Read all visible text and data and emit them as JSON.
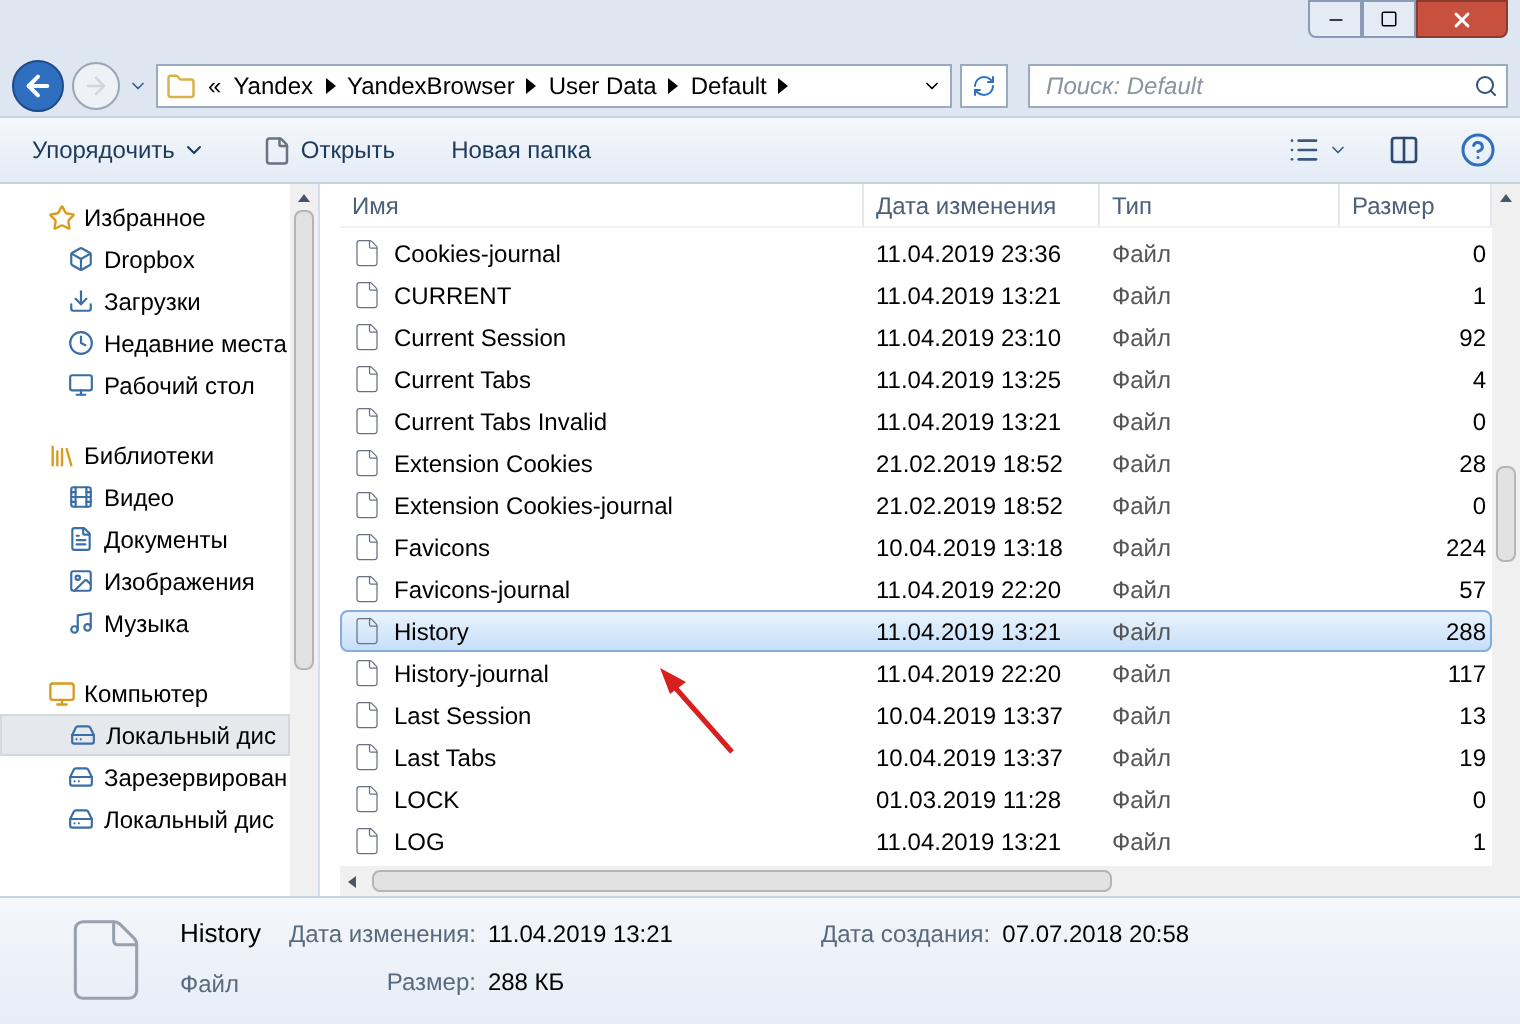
{
  "address": {
    "overflow": "«",
    "path": [
      "Yandex",
      "YandexBrowser",
      "User Data",
      "Default"
    ]
  },
  "search": {
    "placeholder": "Поиск: Default"
  },
  "toolbar": [
    {
      "label": "Упорядочить",
      "kind": "menu"
    },
    {
      "label": "Открыть",
      "kind": "open"
    },
    {
      "label": "Новая папка",
      "kind": "plain"
    }
  ],
  "nav": [
    {
      "label": "Избранное",
      "children": [
        {
          "label": "Dropbox",
          "selected": false
        },
        {
          "label": "Загрузки",
          "selected": false
        },
        {
          "label": "Недавние места",
          "selected": false
        },
        {
          "label": "Рабочий стол",
          "selected": false
        }
      ]
    },
    {
      "label": "Библиотеки",
      "children": [
        {
          "label": "Видео",
          "selected": false
        },
        {
          "label": "Документы",
          "selected": false
        },
        {
          "label": "Изображения",
          "selected": false
        },
        {
          "label": "Музыка",
          "selected": false
        }
      ]
    },
    {
      "label": "Компьютер",
      "children": [
        {
          "label": "Локальный дис",
          "selected": true
        },
        {
          "label": "Зарезервирован",
          "selected": false
        },
        {
          "label": "Локальный дис",
          "selected": false
        }
      ]
    }
  ],
  "columns": [
    "Имя",
    "Дата изменения",
    "Тип",
    "Размер"
  ],
  "rows": [
    {
      "name": "Cookies-journal",
      "date": "11.04.2019 23:36",
      "type": "Файл",
      "size": "0",
      "selected": false
    },
    {
      "name": "CURRENT",
      "date": "11.04.2019 13:21",
      "type": "Файл",
      "size": "1",
      "selected": false
    },
    {
      "name": "Current Session",
      "date": "11.04.2019 23:10",
      "type": "Файл",
      "size": "92",
      "selected": false
    },
    {
      "name": "Current Tabs",
      "date": "11.04.2019 13:25",
      "type": "Файл",
      "size": "4",
      "selected": false
    },
    {
      "name": "Current Tabs Invalid",
      "date": "11.04.2019 13:21",
      "type": "Файл",
      "size": "0",
      "selected": false
    },
    {
      "name": "Extension Cookies",
      "date": "21.02.2019 18:52",
      "type": "Файл",
      "size": "28",
      "selected": false
    },
    {
      "name": "Extension Cookies-journal",
      "date": "21.02.2019 18:52",
      "type": "Файл",
      "size": "0",
      "selected": false
    },
    {
      "name": "Favicons",
      "date": "10.04.2019 13:18",
      "type": "Файл",
      "size": "224",
      "selected": false
    },
    {
      "name": "Favicons-journal",
      "date": "11.04.2019 22:20",
      "type": "Файл",
      "size": "57",
      "selected": false
    },
    {
      "name": "History",
      "date": "11.04.2019 13:21",
      "type": "Файл",
      "size": "288",
      "selected": true
    },
    {
      "name": "History-journal",
      "date": "11.04.2019 22:20",
      "type": "Файл",
      "size": "117",
      "selected": false
    },
    {
      "name": "Last Session",
      "date": "10.04.2019 13:37",
      "type": "Файл",
      "size": "13",
      "selected": false
    },
    {
      "name": "Last Tabs",
      "date": "10.04.2019 13:37",
      "type": "Файл",
      "size": "19",
      "selected": false
    },
    {
      "name": "LOCK",
      "date": "01.03.2019 11:28",
      "type": "Файл",
      "size": "0",
      "selected": false
    },
    {
      "name": "LOG",
      "date": "11.04.2019 13:21",
      "type": "Файл",
      "size": "1",
      "selected": false
    }
  ],
  "details": {
    "name": "History",
    "type": "Файл",
    "fields": [
      {
        "label": "Дата изменения:",
        "value": "11.04.2019 13:21"
      },
      {
        "label": "Размер:",
        "value": "288 КБ"
      },
      {
        "label": "Дата создания:",
        "value": "07.07.2018 20:58"
      }
    ]
  }
}
